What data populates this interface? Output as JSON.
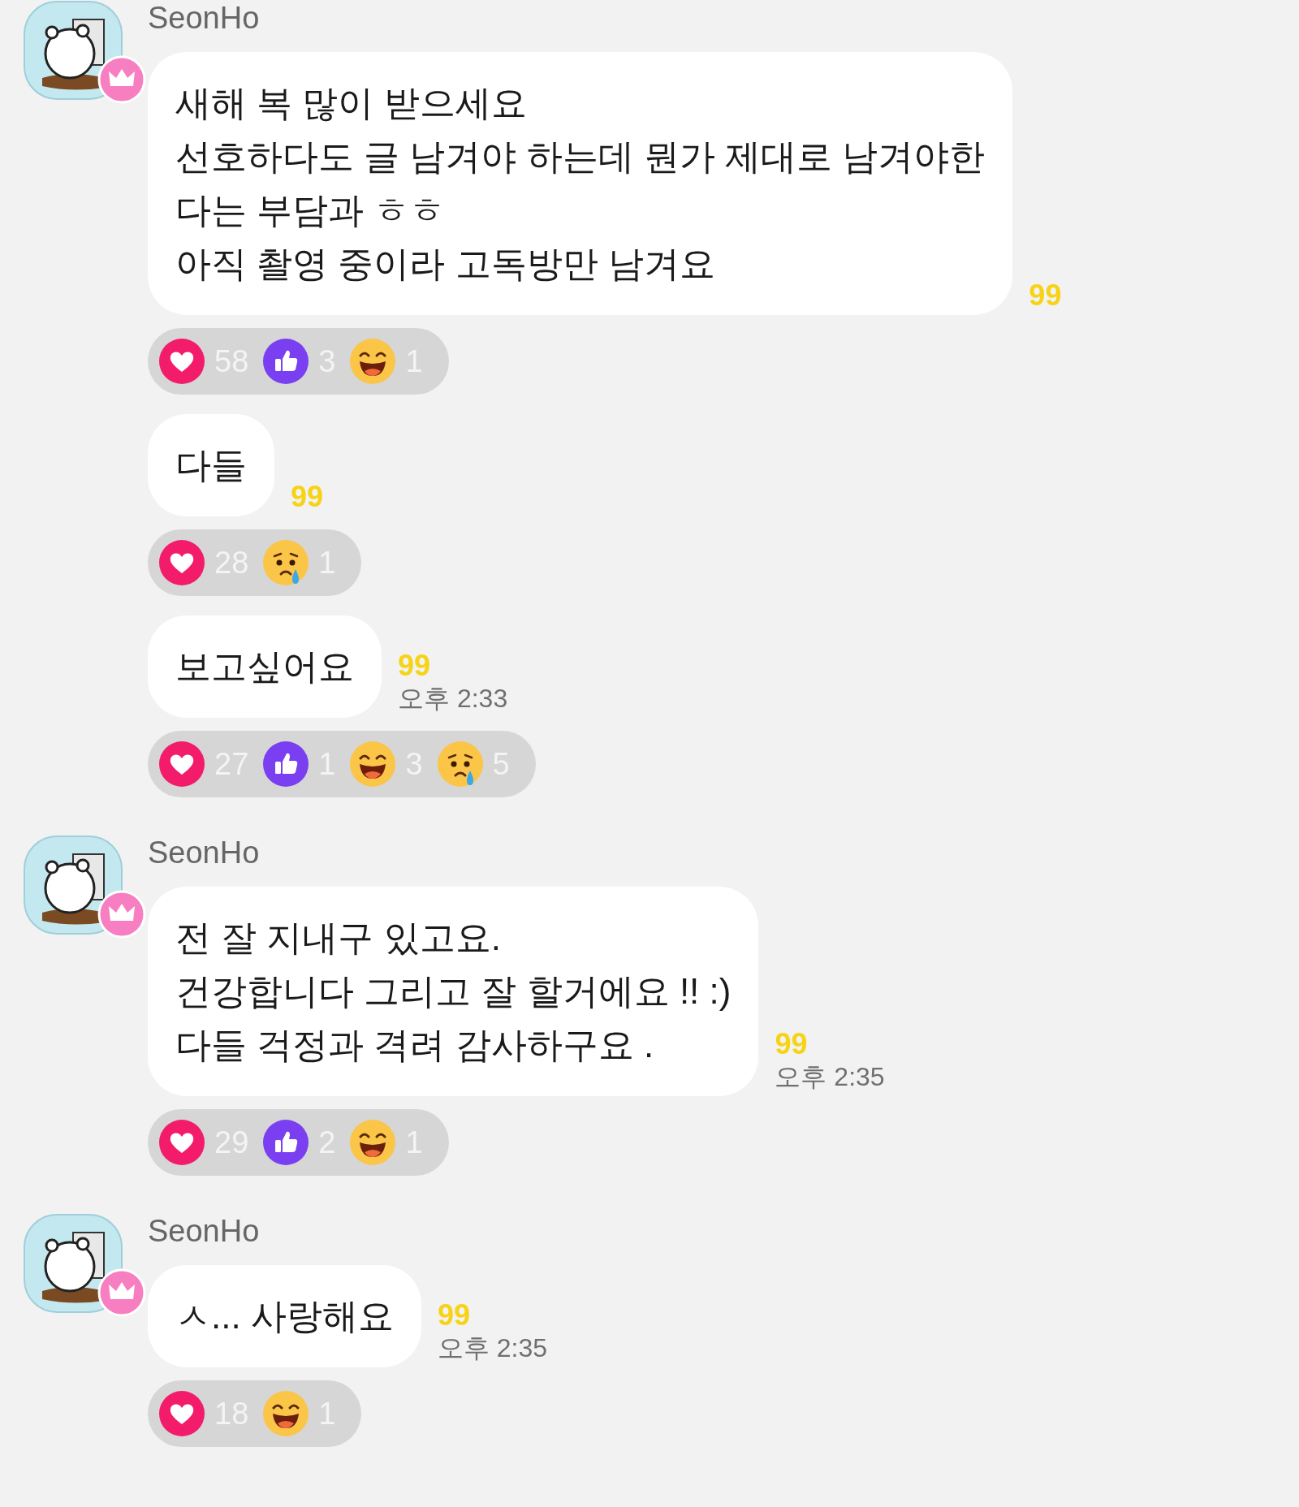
{
  "groups": [
    {
      "sender": "SeonHo",
      "messages": [
        {
          "lines": [
            "새해 복 많이 받으세요",
            "선호하다도 글 남겨야 하는데 뭔가 제대로 남겨야한",
            "다는 부담과 ㅎㅎ",
            "아직 촬영 중이라 고독방만 남겨요"
          ],
          "unread": "99",
          "reactions": [
            {
              "kind": "heart",
              "count": "58"
            },
            {
              "kind": "like",
              "count": "3"
            },
            {
              "kind": "laugh",
              "count": "1"
            }
          ]
        },
        {
          "lines": [
            "다들"
          ],
          "unread": "99",
          "reactions": [
            {
              "kind": "heart",
              "count": "28"
            },
            {
              "kind": "sad",
              "count": "1"
            }
          ]
        },
        {
          "lines": [
            "보고싶어요"
          ],
          "unread": "99",
          "time": "오후 2:33",
          "reactions": [
            {
              "kind": "heart",
              "count": "27"
            },
            {
              "kind": "like",
              "count": "1"
            },
            {
              "kind": "laugh",
              "count": "3"
            },
            {
              "kind": "sad",
              "count": "5"
            }
          ]
        }
      ]
    },
    {
      "sender": "SeonHo",
      "messages": [
        {
          "lines": [
            "전 잘 지내구 있고요.",
            "건강합니다 그리고 잘 할거에요 !! :)",
            "다들 걱정과 격려 감사하구요 ."
          ],
          "unread": "99",
          "time": "오후 2:35",
          "reactions": [
            {
              "kind": "heart",
              "count": "29"
            },
            {
              "kind": "like",
              "count": "2"
            },
            {
              "kind": "laugh",
              "count": "1"
            }
          ]
        }
      ]
    },
    {
      "sender": "SeonHo",
      "messages": [
        {
          "lines": [
            "ㅅ... 사랑해요"
          ],
          "unread": "99",
          "time": "오후 2:35",
          "reactions": [
            {
              "kind": "heart",
              "count": "18"
            },
            {
              "kind": "laugh",
              "count": "1"
            }
          ]
        }
      ]
    }
  ]
}
